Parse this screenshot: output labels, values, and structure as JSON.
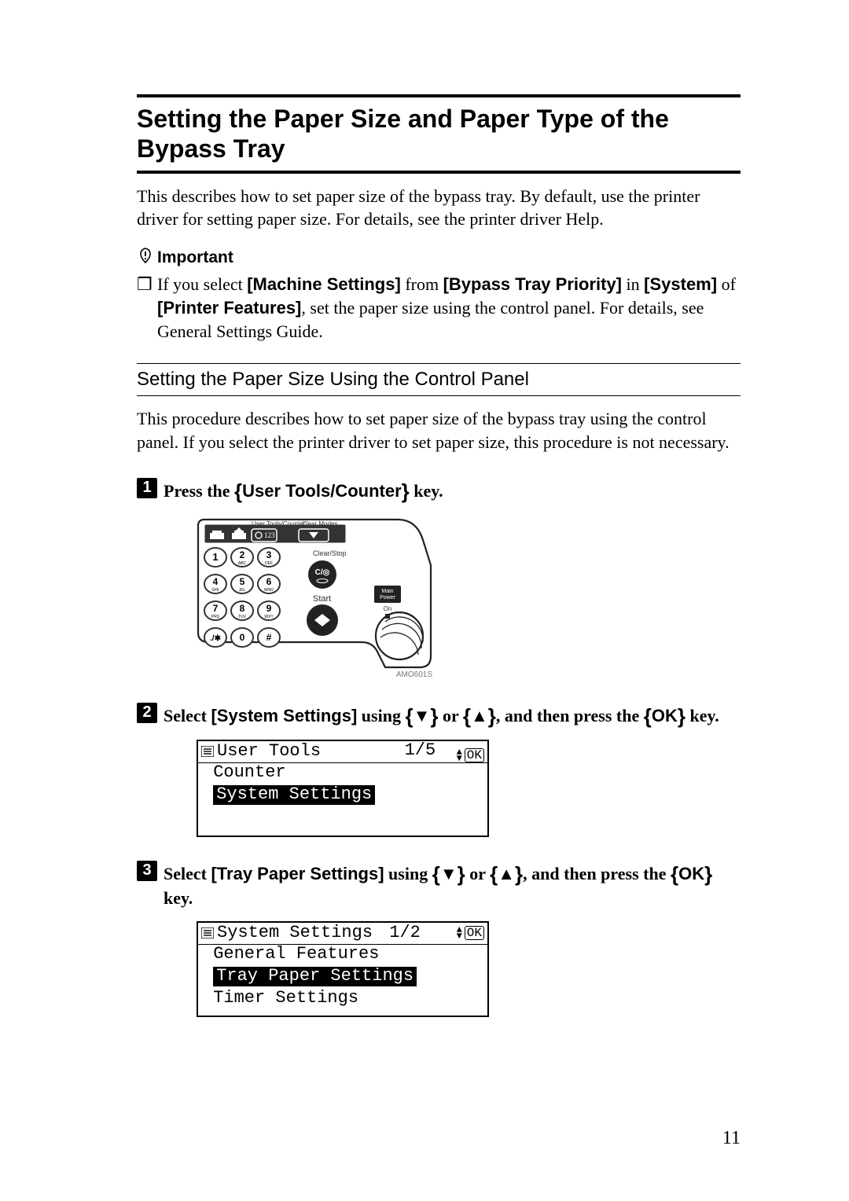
{
  "h1": "Setting the Paper Size and Paper Type of the Bypass Tray",
  "intro": "This describes how to set paper size of the bypass tray. By default, use the printer driver for setting paper size. For details, see the printer driver Help.",
  "important_label": "Important",
  "bullet": {
    "pre": "If you select ",
    "ms": "[Machine Settings]",
    "mid1": " from ",
    "btp": "[Bypass Tray Priority]",
    "mid2": " in ",
    "sys": "[System]",
    "mid3": " of ",
    "pf": "[Printer Features]",
    "tail": ", set the paper size using the control panel. For details, see General Settings Guide."
  },
  "h2": "Setting the Paper Size Using the Control Panel",
  "para2": "This procedure describes how to set paper size of the bypass tray using the control panel. If you select the printer driver to set paper size, this procedure is not necessary.",
  "steps": {
    "s1": {
      "num": "1",
      "pre": "Press the ",
      "key": "User Tools/Counter",
      "tail": " key."
    },
    "s2": {
      "num": "2",
      "pre": "Select ",
      "menu": "[System Settings]",
      "mid": " using ",
      "tail": ", and then press the ",
      "okkey": "OK",
      "end": " key."
    },
    "s3": {
      "num": "3",
      "pre": "Select ",
      "menu": "[Tray Paper Settings]",
      "mid": " using ",
      "tail": ", and then press the ",
      "okkey": "OK",
      "end": " key."
    }
  },
  "keypad": {
    "top_label": "User Tools/Counter",
    "clear_modes": "Clear Modes",
    "clear_stop": "Clear/Stop",
    "start": "Start",
    "main_power": "Main Power",
    "on": "On",
    "keys_row1": [
      "1",
      "2",
      "3"
    ],
    "keys_row1_sub": [
      "",
      "ABC",
      "DEF"
    ],
    "keys_row2": [
      "4",
      "5",
      "6"
    ],
    "keys_row2_sub": [
      "GHI",
      "JKL",
      "MNO"
    ],
    "keys_row3": [
      "7",
      "8",
      "9"
    ],
    "keys_row3_sub": [
      "PRS",
      "TUV",
      "WXY"
    ],
    "keys_row4": [
      "./✱",
      "0",
      "#"
    ]
  },
  "fig_code": "AMO601S",
  "lcd1": {
    "title": "User Tools",
    "page": "1/5",
    "ok": "OK",
    "row1": "Counter",
    "row2": "System Settings"
  },
  "lcd2": {
    "title": "System Settings",
    "page": "1/2",
    "ok": "OK",
    "row1": "General Features",
    "row2": "Tray Paper Settings",
    "row3": "Timer Settings"
  },
  "page_number": "11"
}
